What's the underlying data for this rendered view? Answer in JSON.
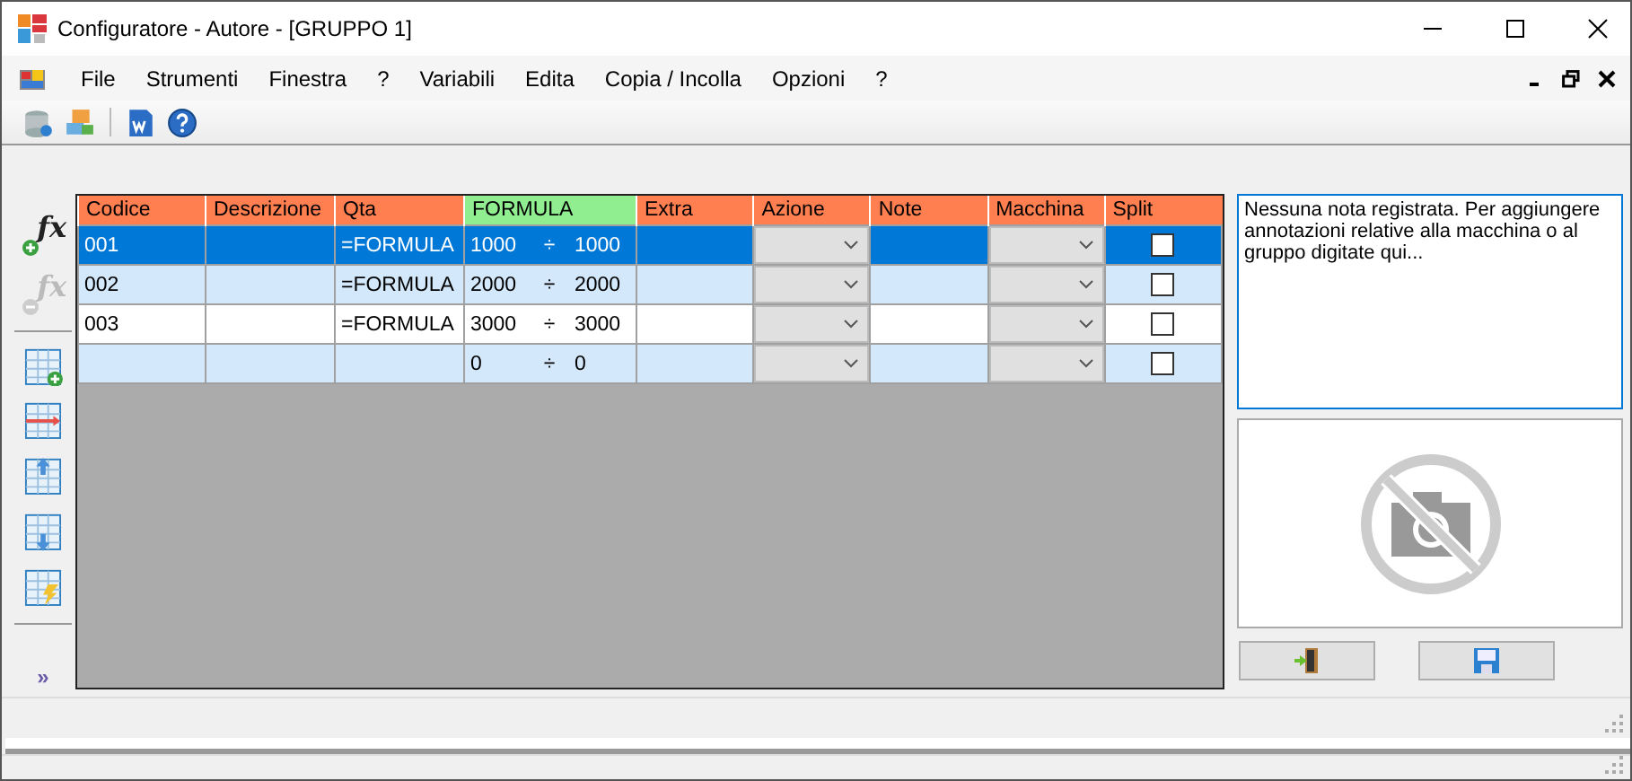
{
  "window": {
    "title": "Configuratore - Autore - [GRUPPO 1]"
  },
  "menu": [
    "File",
    "Strumenti",
    "Finestra",
    "?",
    "Variabili",
    "Edita",
    "Copia / Incolla",
    "Opzioni",
    "?"
  ],
  "table": {
    "columns": [
      {
        "label": "Codice",
        "highlighted": false
      },
      {
        "label": "Descrizione",
        "highlighted": false
      },
      {
        "label": "Qta",
        "highlighted": false
      },
      {
        "label": "FORMULA",
        "highlighted": true
      },
      {
        "label": "Extra",
        "highlighted": false
      },
      {
        "label": "Azione",
        "highlighted": false
      },
      {
        "label": "Note",
        "highlighted": false
      },
      {
        "label": "Macchina",
        "highlighted": false
      },
      {
        "label": "Split",
        "highlighted": false
      }
    ],
    "rows": [
      {
        "selected": true,
        "codice": "001",
        "qta": "=FORMULA",
        "formula_from": "1000",
        "formula_sep": "÷",
        "formula_to": "1000",
        "split_checked": false
      },
      {
        "selected": false,
        "codice": "002",
        "qta": "=FORMULA",
        "formula_from": "2000",
        "formula_sep": "÷",
        "formula_to": "2000",
        "split_checked": false
      },
      {
        "selected": false,
        "codice": "003",
        "qta": "=FORMULA",
        "formula_from": "3000",
        "formula_sep": "÷",
        "formula_to": "3000",
        "split_checked": false
      },
      {
        "selected": false,
        "codice": "",
        "qta": "",
        "formula_from": "0",
        "formula_sep": "÷",
        "formula_to": "0",
        "split_checked": false
      }
    ]
  },
  "formula_tools": [
    {
      "glyph": "fx",
      "disabled": false
    },
    {
      "glyph": "fx",
      "disabled": true
    }
  ],
  "side_toggle": "»",
  "notes": {
    "placeholder": "Nessuna nota registrata. Per aggiungere annotazioni relative alla macchina o al gruppo digitate qui..."
  }
}
